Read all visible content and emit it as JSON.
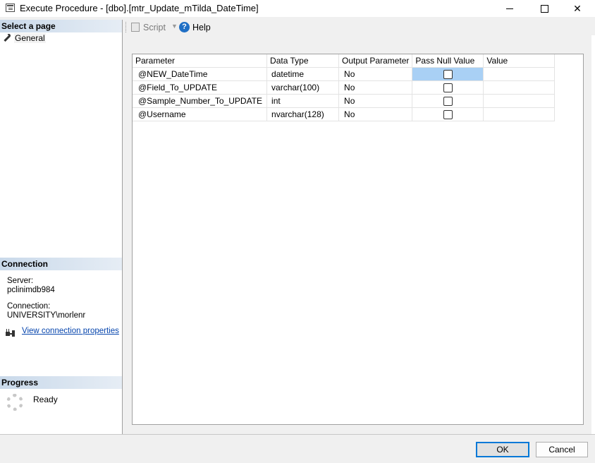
{
  "window": {
    "title": "Execute Procedure - [dbo].[mtr_Update_mTilda_DateTime]"
  },
  "left_pane": {
    "select_page_header": "Select a page",
    "pages": [
      {
        "label": "General",
        "icon": "wrench-icon",
        "selected": true
      }
    ],
    "connection_header": "Connection",
    "server_label": "Server:",
    "server_value": "pclinimdb984",
    "connection_label": "Connection:",
    "connection_value": "UNIVERSITY\\morlenr",
    "view_connection_link": "View connection properties",
    "progress_header": "Progress",
    "progress_status": "Ready"
  },
  "toolbar": {
    "script_label": "Script",
    "help_label": "Help"
  },
  "grid": {
    "columns": [
      "Parameter",
      "Data Type",
      "Output Parameter",
      "Pass Null Value",
      "Value"
    ],
    "rows": [
      {
        "parameter": "@NEW_DateTime",
        "data_type": "datetime",
        "output": "No",
        "pass_null": false,
        "value": ""
      },
      {
        "parameter": "@Field_To_UPDATE",
        "data_type": "varchar(100)",
        "output": "No",
        "pass_null": false,
        "value": ""
      },
      {
        "parameter": "@Sample_Number_To_UPDATE",
        "data_type": "int",
        "output": "No",
        "pass_null": false,
        "value": ""
      },
      {
        "parameter": "@Username",
        "data_type": "nvarchar(128)",
        "output": "No",
        "pass_null": false,
        "value": ""
      }
    ]
  },
  "buttons": {
    "ok": "OK",
    "cancel": "Cancel"
  },
  "colors": {
    "selected_cell": "#a9d0f5",
    "section_header": "#c9d9ea",
    "link": "#0645ad",
    "help_icon": "#1f6fc5"
  }
}
